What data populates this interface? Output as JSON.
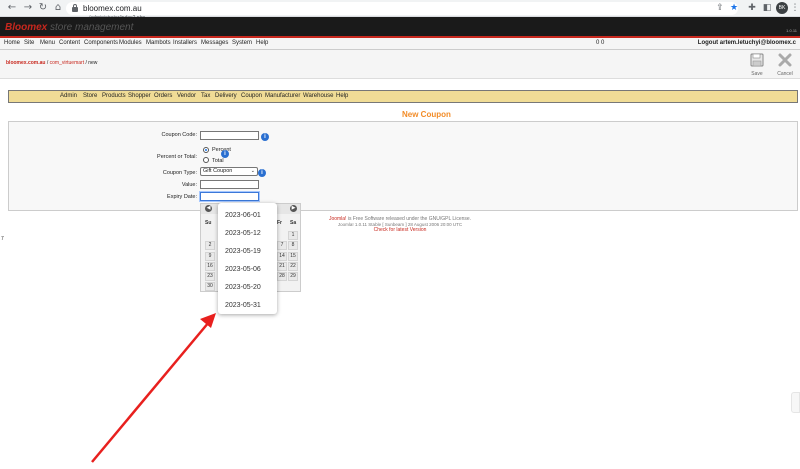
{
  "browser": {
    "url_host": "bloomex.com.au",
    "url_path": "/administrator/index2.php",
    "avatar_initials": "BK"
  },
  "header": {
    "brand": "Bloomex",
    "brand_sub": "store management",
    "version": "1.0.11"
  },
  "menubar": {
    "items": [
      "Home",
      "Site",
      "Menu",
      "Content",
      "Components",
      "Modules",
      "Mambots",
      "Installers",
      "Messages",
      "System",
      "Help"
    ],
    "counts": "0   0",
    "logout": "Logout artem.letuchyi@bloomex.c"
  },
  "pathbar": {
    "site": "bloomex.com.au",
    "sep1": " / ",
    "component": "com_virtuemart",
    "sep2": " / ",
    "current": "new"
  },
  "toolbar": {
    "save_label": "Save",
    "cancel_label": "Cancel"
  },
  "vm_nav": {
    "items": [
      "Admin",
      "Store",
      "Products",
      "Shopper",
      "Orders",
      "Vendor",
      "Tax",
      "Delivery",
      "Coupon",
      "Manufacturer",
      "Warehouse",
      "Help"
    ]
  },
  "page_title": "New Coupon",
  "form": {
    "coupon_code_label": "Coupon Code:",
    "percent_total_label": "Percent or Total:",
    "percent_option": "Percent",
    "total_option": "Total",
    "coupon_type_label": "Coupon Type:",
    "coupon_type_value": "Gift Coupon",
    "value_label": "Value:",
    "expiry_label": "Expiry Date:"
  },
  "calendar": {
    "dow": [
      "Su",
      "Fr",
      "Sa"
    ],
    "rows": [
      [
        "",
        "",
        "1"
      ],
      [
        "2",
        "7",
        "8"
      ],
      [
        "9",
        "14",
        "15"
      ],
      [
        "16",
        "21",
        "22"
      ],
      [
        "23",
        "28",
        "29"
      ],
      [
        "30",
        "",
        ""
      ]
    ]
  },
  "autocomplete": {
    "items": [
      "2023-06-01",
      "2023-05-12",
      "2023-05-19",
      "2023-05-06",
      "2023-05-20",
      "2023-05-31"
    ]
  },
  "footer": {
    "joomla": "Joomla!",
    "license": " is Free Software released under the GNU/GPL License.",
    "version_line": "Joomla! 1.0.11 Stable [ Sunbeam ] 28 August 2006 20:00 UTC",
    "check": "Check for latest Version"
  },
  "left_mark": "7",
  "colors": {
    "accent_red": "#c8281e",
    "title_orange": "#f28c28",
    "nav_bg": "#f0dc96",
    "annotation_arrow": "#e8201e"
  }
}
